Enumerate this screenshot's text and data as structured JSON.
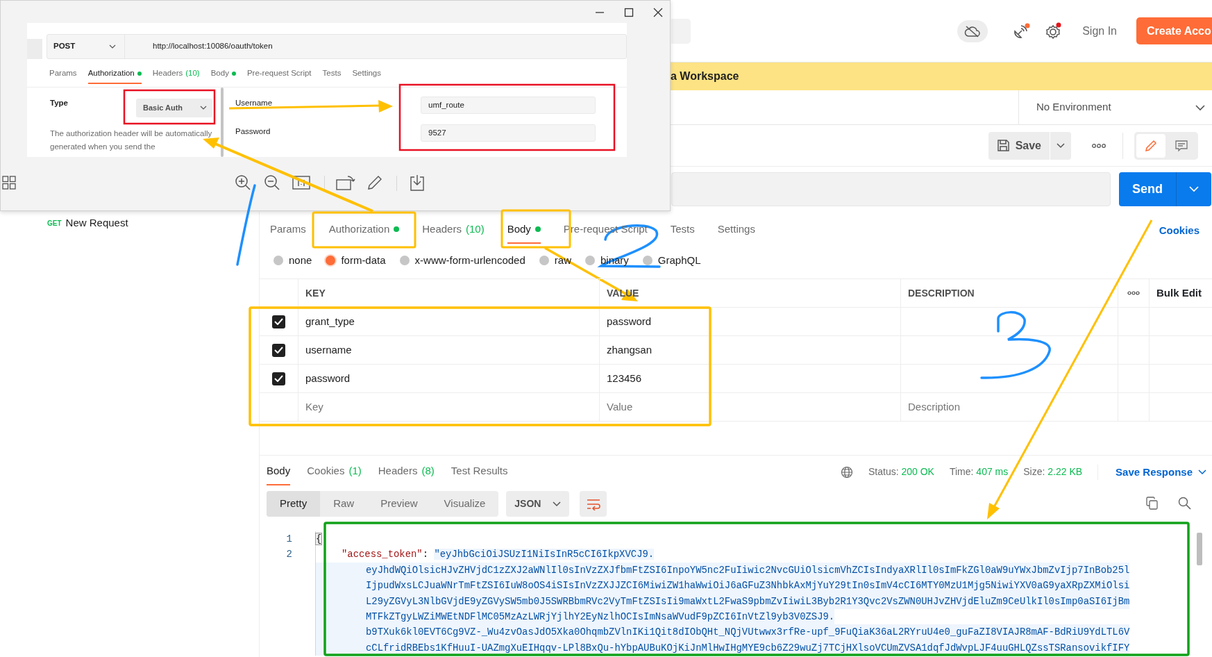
{
  "viewer": {
    "shot": {
      "method": "POST",
      "url": "http://localhost:10086/oauth/token",
      "tabs": [
        {
          "label": "Params",
          "selected": false,
          "dot": false
        },
        {
          "label": "Authorization",
          "selected": true,
          "dot": true
        },
        {
          "label": "Headers",
          "count": "(10)",
          "selected": false,
          "dot": false
        },
        {
          "label": "Body",
          "selected": false,
          "dot": true
        },
        {
          "label": "Pre-request Script",
          "selected": false,
          "dot": false
        },
        {
          "label": "Tests",
          "selected": false,
          "dot": false
        },
        {
          "label": "Settings",
          "selected": false,
          "dot": false
        }
      ],
      "type_label": "Type",
      "auth_type": "Basic Auth",
      "description": "The authorization header will be automatically generated when you send the",
      "credentials": [
        {
          "label": "Username",
          "value": "umf_route"
        },
        {
          "label": "Password",
          "value": "9527"
        }
      ]
    }
  },
  "topbar": {
    "sign_in": "Sign In",
    "create_account": "Create Acco"
  },
  "banner": "a Workspace",
  "environment": "No Environment",
  "save_button": "Save",
  "side_toggle": [
    {
      "kind": "edit",
      "selected": true
    },
    {
      "kind": "comments",
      "selected": false
    }
  ],
  "send_button": "Send",
  "sidebar": {
    "items": [
      {
        "method": "GET",
        "label": "New Request"
      }
    ]
  },
  "request_tabs": [
    {
      "label": "Params",
      "selected": false,
      "dot": false
    },
    {
      "label": "Authorization",
      "selected": false,
      "dot": true
    },
    {
      "label": "Headers",
      "count": "(10)",
      "selected": false,
      "dot": false
    },
    {
      "label": "Body",
      "selected": true,
      "dot": true
    },
    {
      "label": "Pre-request Script",
      "selected": false,
      "dot": false
    },
    {
      "label": "Tests",
      "selected": false,
      "dot": false
    },
    {
      "label": "Settings",
      "selected": false,
      "dot": false
    }
  ],
  "cookies_link": "Cookies",
  "body_types": [
    {
      "label": "none",
      "selected": false
    },
    {
      "label": "form-data",
      "selected": true
    },
    {
      "label": "x-www-form-urlencoded",
      "selected": false
    },
    {
      "label": "raw",
      "selected": false
    },
    {
      "label": "binary",
      "selected": false
    },
    {
      "label": "GraphQL",
      "selected": false
    }
  ],
  "params_table": {
    "columns": [
      "KEY",
      "VALUE",
      "DESCRIPTION"
    ],
    "bulk_edit": "Bulk Edit",
    "rows": [
      {
        "checked": true,
        "key": "grant_type",
        "value": "password"
      },
      {
        "checked": true,
        "key": "username",
        "value": "zhangsan"
      },
      {
        "checked": true,
        "key": "password",
        "value": "123456"
      }
    ],
    "new_row": [
      {
        "placeholder": "Key"
      },
      {
        "placeholder": "Value"
      },
      {
        "placeholder": "Description"
      }
    ]
  },
  "response": {
    "tabs": [
      {
        "label": "Body",
        "selected": true
      },
      {
        "label": "Cookies",
        "count": "(1)",
        "selected": false
      },
      {
        "label": "Headers",
        "count": "(8)",
        "selected": false
      },
      {
        "label": "Test Results",
        "selected": false
      }
    ],
    "status_label": "Status:",
    "status": "200 OK",
    "time_label": "Time:",
    "time": "407 ms",
    "size_label": "Size:",
    "size": "2.22 KB",
    "save_response": "Save Response",
    "view_modes": [
      {
        "label": "Pretty",
        "selected": true
      },
      {
        "label": "Raw",
        "selected": false
      },
      {
        "label": "Preview",
        "selected": false
      },
      {
        "label": "Visualize",
        "selected": false
      }
    ],
    "format": "JSON",
    "lines": [
      {
        "kind": "bracket",
        "number": "1",
        "text": "{"
      },
      {
        "kind": "pair",
        "number": "2",
        "key": "\"access_token\"",
        "text": ": ",
        "value": "\"eyJhbGciOiJSUzI1NiIsInR5cCI6IkpXVCJ9."
      },
      {
        "kind": "continuation",
        "value": "eyJhdWQiOlsicHJvZHVjdC1zZXJ2aWNlIl0sInVzZXJfbmFtZSI6InpoYW5nc2FuIiwic2NvcGUiOlsicmVhZCIsIndyaXRlIl0sImFkZGl0aW9uYWxJbmZvIjp7InBob25l"
      },
      {
        "kind": "continuation",
        "value": "IjpudWxsLCJuaWNrTmFtZSI6IuW8oOS4iSIsInVzZXJJZCI6MiwiZW1haWwiOiJ6aGFuZ3NhbkAxMjYuY29tIn0sImV4cCI6MTY0MzU1Mjg5NiwiYXV0aG9yaXRpZXMiOlsi"
      },
      {
        "kind": "continuation",
        "value": "L29yZGVyL3NlbGVjdE9yZGVySW5mb0J5SWRBbmRVc2VyTmFtZSIsIi9maWxtL2FwaS9pbmZvIiwiL3Byb2R1Y3Qvc2VsZWN0UHJvZHVjdEluZm9CeUlkIl0sImp0aSI6IjBm"
      },
      {
        "kind": "continuation",
        "value": "MTFkZTgyLWZiMWEtNDFlMC05MzAzLWRjYjlhY2EyNzlhOCIsImNsaWVudF9pZCI6InVtZl9yb3V0ZSJ9."
      },
      {
        "kind": "continuation",
        "value": "b9TXuk6kl0EVT6Cg9VZ-_Wu4zvOasJdO5Xka0OhqmbZVlnIKi1Qit8dIObQHt_NQjVUtwwx3rfRe-upf_9FuQiaK36aL2RYruU4e0_guFaZI8VIAJR8mAF-BdRiU9YdLTL6V"
      },
      {
        "kind": "continuation",
        "value": "cCLfridRBEbs1KfHuuI-UAZmgXuEIHqqv-LPl8BxQu-hYbpAUBuKOjKiJnMlHwIHgMYE9cb6Z29wuZj7TCjHXlsoVCUmZVSA1dqfJdWvpLJF4uuGHLQZssTSRansovikfIFY"
      }
    ]
  }
}
